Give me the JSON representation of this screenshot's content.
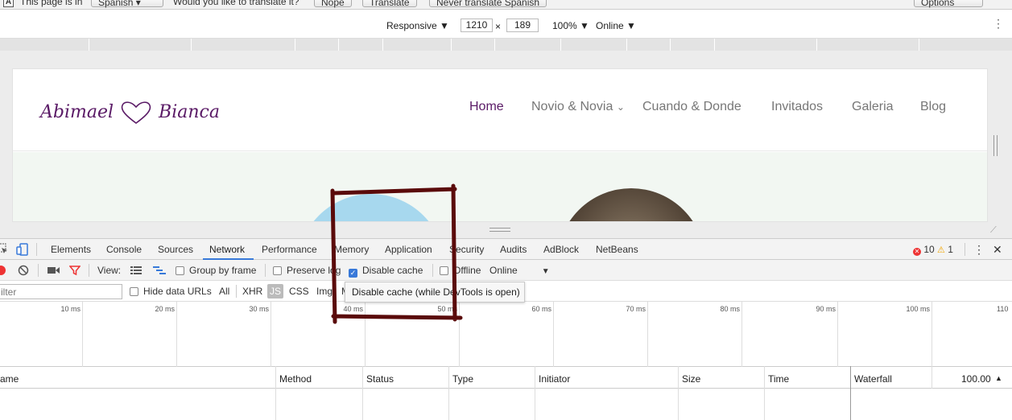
{
  "translate_bar": {
    "prompt": "This page is in",
    "language": "Spanish",
    "question": "Would you like to translate it?",
    "nope": "Nope",
    "translate": "Translate",
    "never": "Never translate Spanish",
    "options": "Options"
  },
  "device_toolbar": {
    "mode": "Responsive ▼",
    "width": "1210",
    "times": "×",
    "height": "189",
    "zoom": "100% ▼",
    "network": "Online ▼",
    "more": "⋮"
  },
  "site": {
    "logo_left": "Abimael",
    "logo_right": "Bianca",
    "nav": [
      {
        "label": "Home",
        "active": true
      },
      {
        "label": "Novio & Novia",
        "has_dropdown": true
      },
      {
        "label": "Cuando & Donde"
      },
      {
        "label": "Invitados"
      },
      {
        "label": "Galeria"
      },
      {
        "label": "Blog"
      }
    ],
    "dropdown_caret": "⌄"
  },
  "devtools": {
    "tabs": [
      "Elements",
      "Console",
      "Sources",
      "Network",
      "Performance",
      "Memory",
      "Application",
      "Security",
      "Audits",
      "AdBlock",
      "NetBeans"
    ],
    "active_tab": "Network",
    "errors": "10",
    "warnings": "1",
    "more": "⋮",
    "close": "✕",
    "network_toolbar": {
      "view_label": "View:",
      "group_by_frame": "Group by frame",
      "preserve_log": "Preserve log",
      "disable_cache": "Disable cache",
      "offline": "Offline",
      "throttle": "Online",
      "throttle_caret": "▼"
    },
    "filter": {
      "placeholder": "Filter",
      "visible_placeholder": "ilter",
      "hide_data_urls": "Hide data URLs",
      "types": [
        "All",
        "XHR",
        "JS",
        "CSS",
        "Img",
        "M"
      ]
    },
    "tooltip": "Disable cache (while DevTools is open)",
    "timeline_ticks": [
      "10 ms",
      "20 ms",
      "30 ms",
      "40 ms",
      "50 ms",
      "60 ms",
      "70 ms",
      "80 ms",
      "90 ms",
      "100 ms",
      "110"
    ],
    "columns": [
      "ame",
      "Method",
      "Status",
      "Type",
      "Initiator",
      "Size",
      "Time",
      "Waterfall",
      "100.00"
    ],
    "sort_caret": "▲"
  },
  "colors": {
    "brand_purple": "#5a1a66",
    "devtools_blue": "#3879d9",
    "annotation_stroke": "#5a0a0a"
  }
}
